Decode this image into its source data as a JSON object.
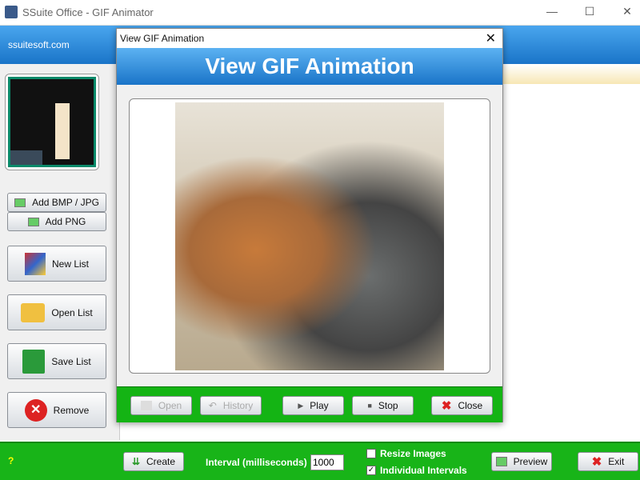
{
  "window": {
    "title": "SSuite Office - GIF Animator",
    "minimize": "—",
    "maximize": "☐",
    "close": "✕"
  },
  "header": {
    "site": "ssuitesoft.com"
  },
  "sidebar": {
    "buttons": [
      {
        "label": "Add BMP / JPG"
      },
      {
        "label": "Add PNG"
      },
      {
        "label": "New List"
      },
      {
        "label": "Open List"
      },
      {
        "label": "Save List"
      },
      {
        "label": "Remove"
      }
    ]
  },
  "dialog": {
    "title": "View GIF Animation",
    "close": "✕",
    "banner": "View GIF Animation",
    "buttons": [
      {
        "label": "Open",
        "enabled": false
      },
      {
        "label": "History",
        "enabled": false
      },
      {
        "label": "Play",
        "enabled": true
      },
      {
        "label": "Stop",
        "enabled": true
      },
      {
        "label": "Close",
        "enabled": true
      }
    ]
  },
  "bottom": {
    "help": "?",
    "create": "Create",
    "interval_label": "Interval (milliseconds)",
    "interval_value": "1000",
    "resize_label": "Resize Images",
    "resize_checked": false,
    "individual_label": "Individual Intervals",
    "individual_checked": true,
    "preview": "Preview",
    "exit": "Exit"
  },
  "colors": {
    "blue": "#1a74c8",
    "green": "#18b418"
  }
}
